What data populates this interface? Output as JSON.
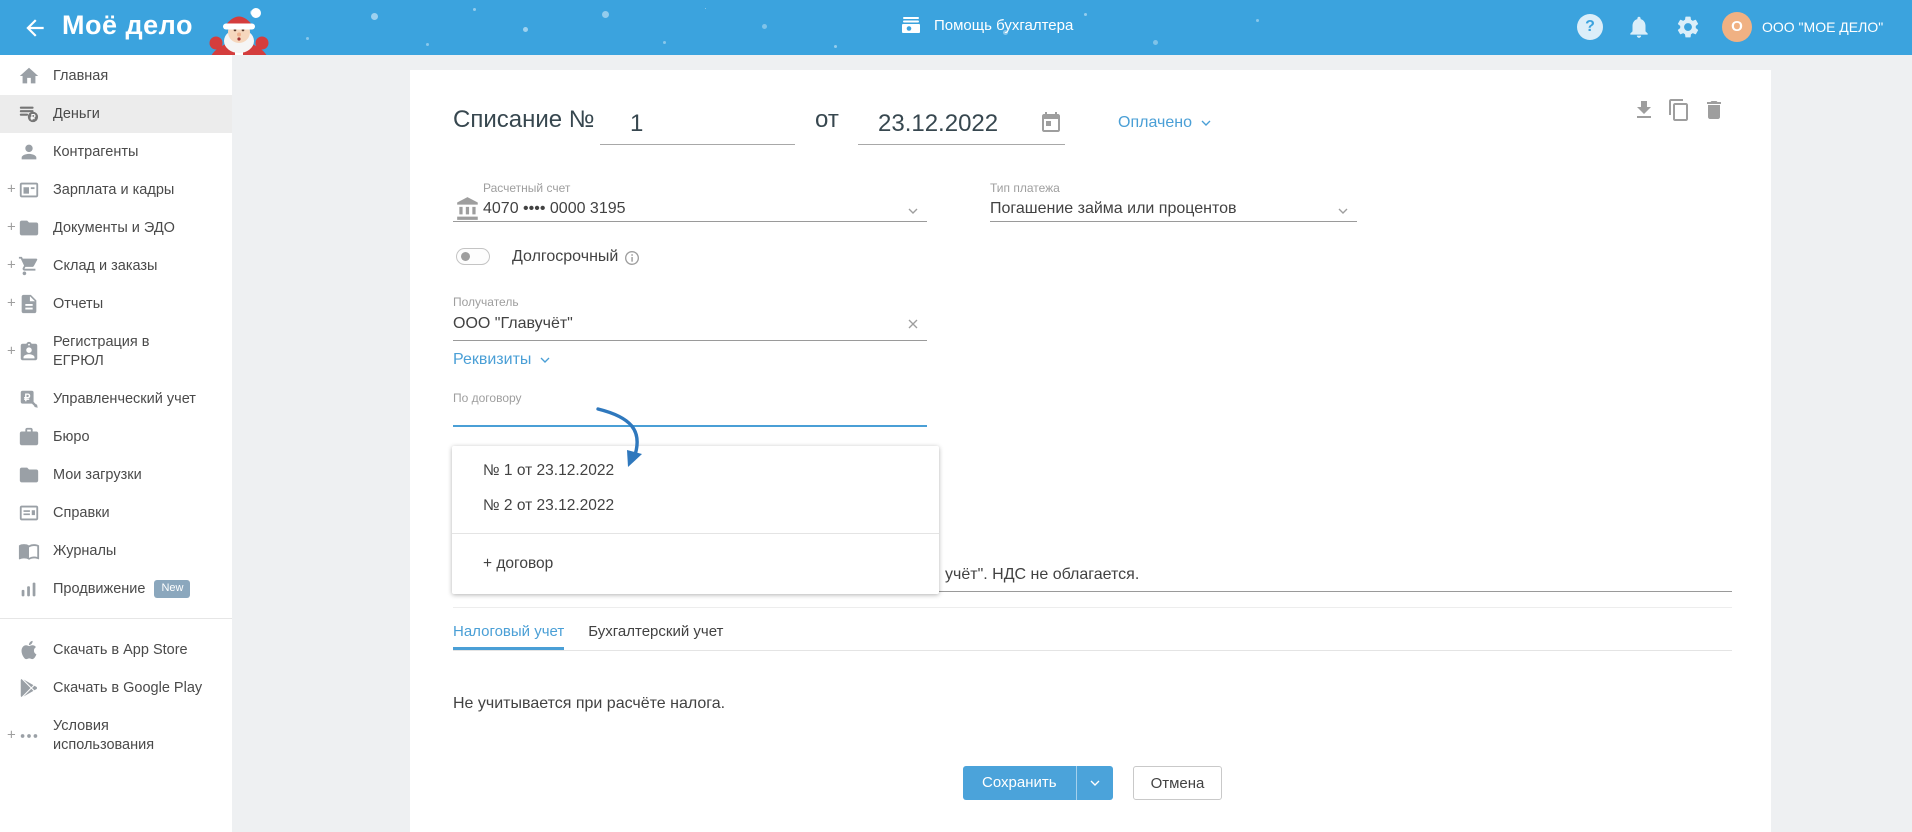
{
  "header": {
    "logo": "Моё дело",
    "assistant_label": "Помощь бухгалтера",
    "company": "ООО \"МОЕ ДЕЛО\"",
    "avatar_letter": "O",
    "icons": [
      "help",
      "notifications",
      "settings"
    ]
  },
  "colors": {
    "header_bar": "#3ba3de",
    "accent_blue": "#4a9fd6",
    "save_button": "#4ba3da",
    "avatar_bg": "#f0b183",
    "new_badge": "#8ba7bd"
  },
  "sidebar": {
    "items": [
      {
        "label": "Главная",
        "icon": "home-icon",
        "expandable": false,
        "active": false
      },
      {
        "label": "Деньги",
        "icon": "money-icon",
        "expandable": false,
        "active": true
      },
      {
        "label": "Контрагенты",
        "icon": "contacts-icon",
        "expandable": false,
        "active": false
      },
      {
        "label": "Зарплата и кадры",
        "icon": "salary-icon",
        "expandable": true,
        "active": false
      },
      {
        "label": "Документы и ЭДО",
        "icon": "documents-icon",
        "expandable": true,
        "active": false
      },
      {
        "label": "Склад и заказы",
        "icon": "warehouse-icon",
        "expandable": true,
        "active": false
      },
      {
        "label": "Отчеты",
        "icon": "reports-icon",
        "expandable": true,
        "active": false
      },
      {
        "label": "Регистрация в ЕГРЮЛ",
        "icon": "registration-icon",
        "expandable": true,
        "active": false
      },
      {
        "label": "Управленческий учет",
        "icon": "management-icon",
        "expandable": false,
        "active": false
      },
      {
        "label": "Бюро",
        "icon": "bureau-icon",
        "expandable": false,
        "active": false
      },
      {
        "label": "Мои загрузки",
        "icon": "downloads-folder-icon",
        "expandable": false,
        "active": false
      },
      {
        "label": "Справки",
        "icon": "certificates-icon",
        "expandable": false,
        "active": false
      },
      {
        "label": "Журналы",
        "icon": "journals-icon",
        "expandable": false,
        "active": false
      },
      {
        "label": "Продвижение",
        "icon": "promotion-icon",
        "expandable": false,
        "active": false,
        "badge": "New"
      }
    ],
    "footer_items": [
      {
        "label": "Скачать в App Store",
        "icon": "apple-icon"
      },
      {
        "label": "Скачать в Google Play",
        "icon": "google-play-icon"
      },
      {
        "label": "Условия использования",
        "icon": "ellipsis-icon",
        "expandable": true
      }
    ]
  },
  "document": {
    "title_prefix": "Списание №",
    "number": "1",
    "date_preposition": "от",
    "date": "23.12.2022",
    "status": "Оплачено"
  },
  "form": {
    "account_label": "Расчетный счет",
    "account_value": "4070 •••• 0000 3195",
    "payment_type_label": "Тип платежа",
    "payment_type_value": "Погашение займа или процентов",
    "long_term_label": "Долгосрочный",
    "long_term_enabled": false,
    "recipient_label": "Получатель",
    "recipient_value": "ООО \"Главучёт\"",
    "details_link": "Реквизиты",
    "contract_label": "По договору",
    "contract_value": "",
    "purpose_visible_fragment": "учёт\". НДС не облагается."
  },
  "contract_dropdown": {
    "options": [
      "№ 1 от 23.12.2022",
      "№ 2 от 23.12.2022"
    ],
    "add_option_label": "+ договор"
  },
  "tabs": [
    {
      "label": "Налоговый учет",
      "active": true
    },
    {
      "label": "Бухгалтерский учет",
      "active": false
    }
  ],
  "tax_tab_content": "Не учитывается при расчёте налога.",
  "actions": {
    "save_label": "Сохранить",
    "cancel_label": "Отмена"
  }
}
